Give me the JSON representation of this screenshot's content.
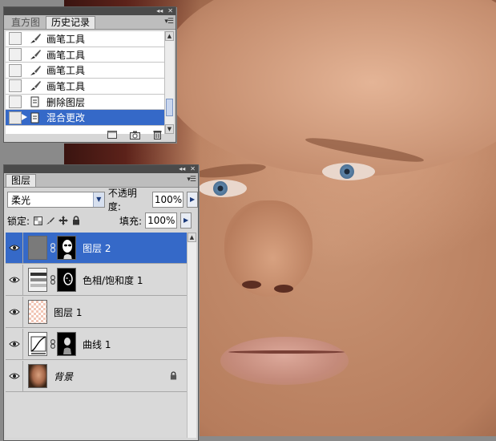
{
  "history_panel": {
    "tabs": [
      {
        "label": "直方图",
        "active": false
      },
      {
        "label": "历史记录",
        "active": true
      }
    ],
    "items": [
      {
        "label": "画笔工具",
        "icon": "brush-icon",
        "selected": false
      },
      {
        "label": "画笔工具",
        "icon": "brush-icon",
        "selected": false
      },
      {
        "label": "画笔工具",
        "icon": "brush-icon",
        "selected": false
      },
      {
        "label": "画笔工具",
        "icon": "brush-icon",
        "selected": false
      },
      {
        "label": "删除图层",
        "icon": "document-icon",
        "selected": false
      },
      {
        "label": "混合更改",
        "icon": "document-icon",
        "selected": true
      }
    ],
    "footer_icons": [
      "new-document-from-state-icon",
      "new-snapshot-icon",
      "trash-icon"
    ]
  },
  "layers_panel": {
    "tab_label": "图层",
    "blend_mode": "柔光",
    "opacity_label": "不透明度:",
    "opacity_value": "100%",
    "lock_label": "锁定:",
    "fill_label": "填充:",
    "fill_value": "100%",
    "lock_icons": [
      "lock-transparent-icon",
      "lock-brush-icon",
      "lock-move-icon",
      "lock-all-icon"
    ],
    "layers": [
      {
        "name": "图层 2",
        "thumb": "gray",
        "mask": true,
        "selected": true
      },
      {
        "name": "色相/饱和度 1",
        "thumb": "hue-sat",
        "mask": true,
        "selected": false
      },
      {
        "name": "图层 1",
        "thumb": "transparent",
        "mask": false,
        "selected": false
      },
      {
        "name": "曲线 1",
        "thumb": "curves",
        "mask": true,
        "selected": false
      },
      {
        "name": "背景",
        "thumb": "photo",
        "mask": false,
        "selected": false,
        "locked": true
      }
    ]
  },
  "colors": {
    "selection_blue": "#3569c8",
    "panel_gray": "#d6d6d6",
    "header_dark": "#4a4a4a"
  }
}
